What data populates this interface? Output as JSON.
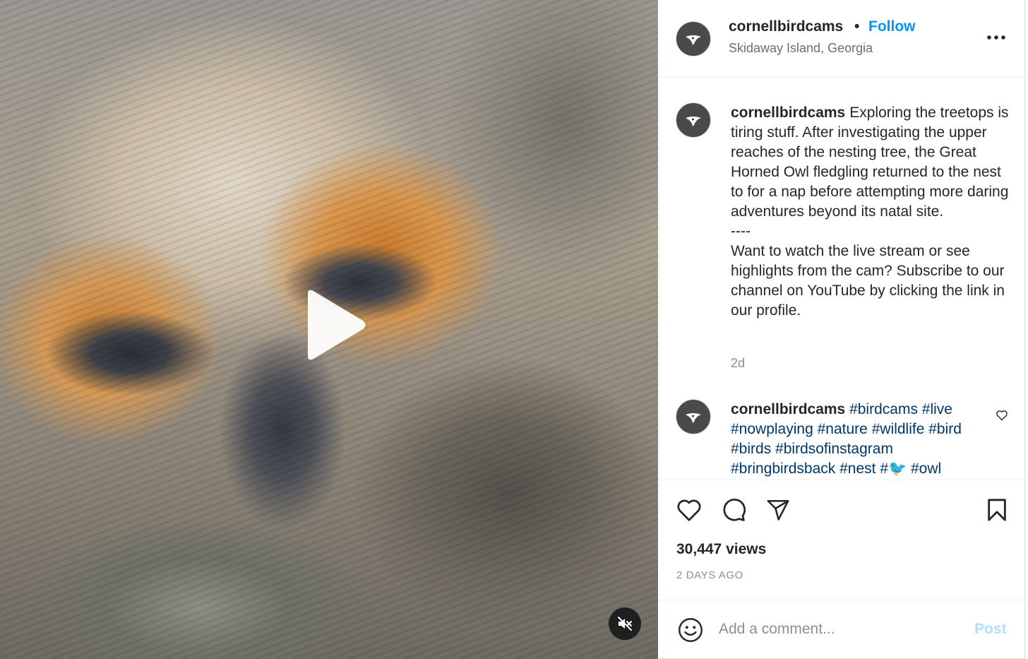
{
  "post": {
    "username": "cornellbirdcams",
    "dot": "•",
    "follow_label": "Follow",
    "location": "Skidaway Island, Georgia"
  },
  "caption": {
    "username": "cornellbirdcams",
    "text": "Exploring the treetops is tiring stuff. After investigating the upper reaches of the nesting tree, the Great Horned Owl fledgling returned to the nest to for a nap before attempting more daring adventures beyond its natal site.\n----\nWant to watch the live stream or see highlights from the cam? Subscribe to our channel on YouTube by clicking the link in our profile.",
    "time": "2d"
  },
  "comment": {
    "username": "cornellbirdcams",
    "tags": [
      "#birdcams",
      "#live",
      "#nowplaying",
      "#nature",
      "#wildlife",
      "#bird",
      "#birds",
      "#birdsofinstagram",
      "#bringbirdsback",
      "#nest",
      "#🐦",
      "#owl"
    ]
  },
  "stats": {
    "views": "30,447 views",
    "date": "2 DAYS AGO"
  },
  "add_comment": {
    "placeholder": "Add a comment...",
    "post_label": "Post"
  },
  "icons": {
    "play": "play-icon",
    "mute": "muted-speaker-icon",
    "more": "more-options-icon",
    "like": "heart-icon",
    "comment": "comment-bubble-icon",
    "share": "paper-plane-icon",
    "save": "bookmark-icon",
    "emoji": "smiley-icon",
    "avatar": "bird-logo-icon"
  },
  "colors": {
    "link": "#0095f6",
    "hashtag": "#00376b",
    "post_disabled": "#b2dffc",
    "muted_text": "#8e8e8e"
  }
}
